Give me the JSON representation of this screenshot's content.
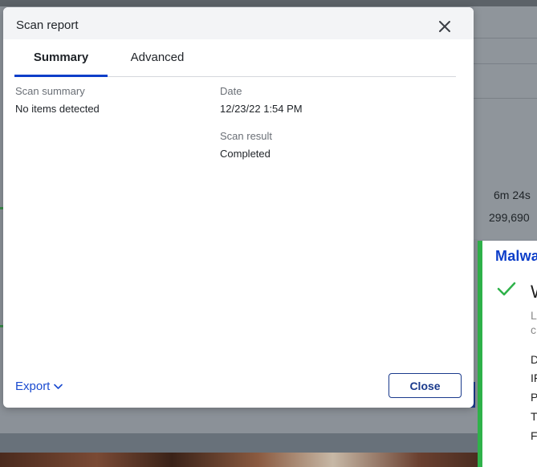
{
  "background": {
    "stats": {
      "duration": "6m 24s",
      "count": "299,690"
    }
  },
  "toast": {
    "brand": "Malwa",
    "heading": "W",
    "sub_lines": [
      "L",
      "c"
    ],
    "items": [
      "D",
      "IF",
      "P",
      "T",
      "F"
    ],
    "accent_color": "#2fb24a",
    "icon": "checkmark-icon"
  },
  "modal": {
    "title": "Scan report",
    "close_icon": "close-icon",
    "tabs": [
      {
        "label": "Summary",
        "active": true
      },
      {
        "label": "Advanced",
        "active": false
      }
    ],
    "fields": {
      "scan_summary_label": "Scan summary",
      "scan_summary_value": "No items detected",
      "date_label": "Date",
      "date_value": "12/23/22 1:54 PM",
      "scan_result_label": "Scan result",
      "scan_result_value": "Completed"
    },
    "export_label": "Export",
    "close_label": "Close",
    "accent_color": "#0d3ec9"
  }
}
